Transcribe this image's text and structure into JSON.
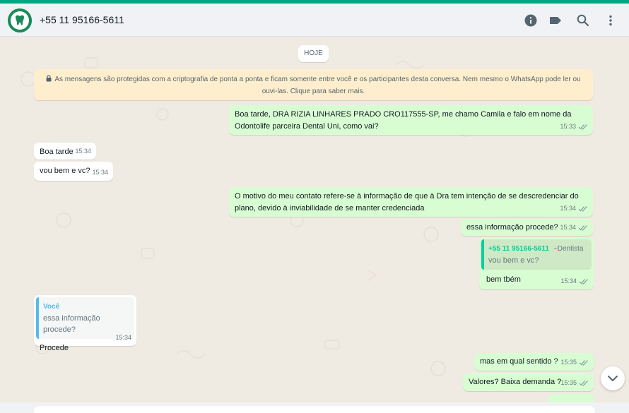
{
  "header": {
    "contact_name": "+55 11 95166-5611",
    "icons": [
      "info-icon",
      "label-icon",
      "search-icon",
      "menu-icon"
    ]
  },
  "chat": {
    "date_chip": "HOJE",
    "encryption_notice": "As mensagens são protegidas com a criptografia de ponta a ponta e ficam somente entre você e os participantes desta conversa. Nem mesmo o WhatsApp pode ler ou ouvi-las. Clique para saber mais.",
    "messages": [
      {
        "dir": "out",
        "text": "Boa tarde, DRA RIZIA LINHARES PRADO CRO117555-SP, me chamo Camila e falo em nome da Odontolife parceira Dental Uni, como vai?",
        "time": "15:33"
      },
      {
        "dir": "in",
        "text": "Boa tarde",
        "time": "15:34"
      },
      {
        "dir": "in",
        "text": "vou bem e vc?",
        "time": "15:34"
      },
      {
        "dir": "out",
        "text": "O motivo do meu contato refere-se à informação de que à Dra tem intenção de se descredenciar do plano, devido à inviabilidade de se manter credenciada",
        "time": "15:34"
      },
      {
        "dir": "out",
        "text": "essa informação procede?",
        "time": "15:34"
      },
      {
        "dir": "out",
        "quote_author": "+55 11 95166-5611",
        "quote_extra": "~Dentista",
        "quote_text": "vou bem e vc?",
        "text": "bem tbém",
        "time": "15:34"
      },
      {
        "dir": "in",
        "quote_author": "Você",
        "quote_text": "essa informação procede?",
        "text": "Procede",
        "time": "15:34"
      },
      {
        "dir": "out",
        "text": "mas em qual sentido ?",
        "time": "15:35"
      },
      {
        "dir": "out",
        "text": "Valores? Baixa demanda ?",
        "time": "15:35"
      }
    ]
  },
  "colors": {
    "accent": "#00a884",
    "outgoing_bubble": "#d9fdd3",
    "incoming_bubble": "#ffffff",
    "chat_background": "#efeae2",
    "read_ticks": "#53bdeb"
  }
}
